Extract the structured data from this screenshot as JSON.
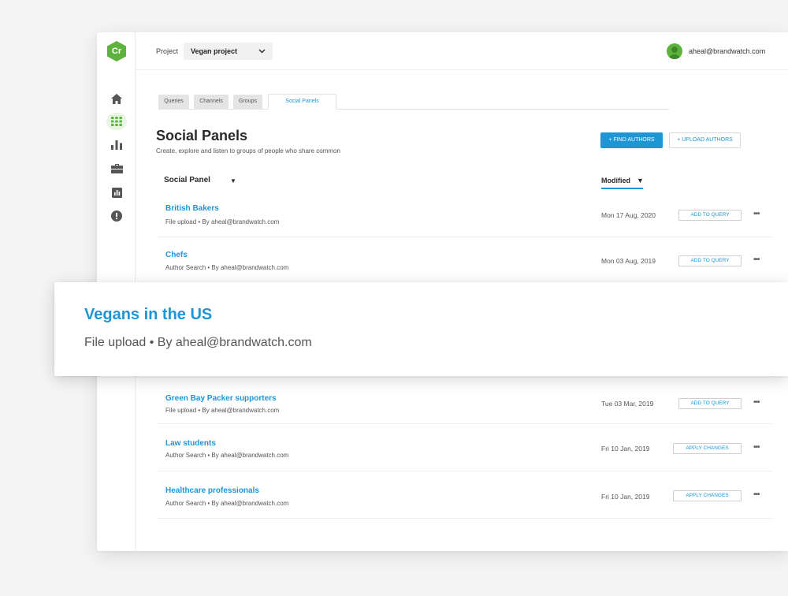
{
  "app": {
    "logo_text": "Cr",
    "brand_color": "#5db33e",
    "accent_color": "#1d96d6"
  },
  "sidebar": {
    "items": [
      {
        "icon": "home-icon"
      },
      {
        "icon": "apps-grid-icon",
        "active": true
      },
      {
        "icon": "bar-chart-icon"
      },
      {
        "icon": "briefcase-icon"
      },
      {
        "icon": "report-icon"
      },
      {
        "icon": "alert-icon"
      }
    ]
  },
  "topbar": {
    "project_label": "Project",
    "project_value": "Vegan project",
    "user_email": "aheal@brandwatch.com"
  },
  "tabs": [
    {
      "label": "Queries"
    },
    {
      "label": "Channels"
    },
    {
      "label": "Groups"
    },
    {
      "label": "Social Panels",
      "active": true
    }
  ],
  "page": {
    "title": "Social Panels",
    "subtitle": "Create, explore and listen to groups of people who share common",
    "find_authors_label": "FIND AUTHORS",
    "upload_authors_label": "UPLOAD AUTHORS"
  },
  "columns": {
    "panel_label": "Social Panel",
    "modified_label": "Modified"
  },
  "rows": [
    {
      "name": "British Bakers",
      "sub": "File upload • By aheal@brandwatch.com",
      "date": "Mon 17 Aug, 2020",
      "action": "ADD TO QUERY"
    },
    {
      "name": "Chefs",
      "sub": "Author Search • By aheal@brandwatch.com",
      "date": "Mon 03 Aug, 2019",
      "action": "ADD TO QUERY"
    },
    {
      "name": "Green Bay Packer supporters",
      "sub": "File upload • By aheal@brandwatch.com",
      "date": "Tue 03 Mar, 2019",
      "action": "ADD TO QUERY"
    },
    {
      "name": "Law students",
      "sub": "Author Search • By aheal@brandwatch.com",
      "date": "Fri 10 Jan, 2019",
      "action": "APPLY CHANGES"
    },
    {
      "name": "Healthcare professionals",
      "sub": "Author Search • By aheal@brandwatch.com",
      "date": "Fri 10 Jan, 2019",
      "action": "APPLY CHANGES"
    }
  ],
  "highlight": {
    "name": "Vegans in the US",
    "sub": "File upload • By aheal@brandwatch.com"
  },
  "more_glyph": "•••"
}
